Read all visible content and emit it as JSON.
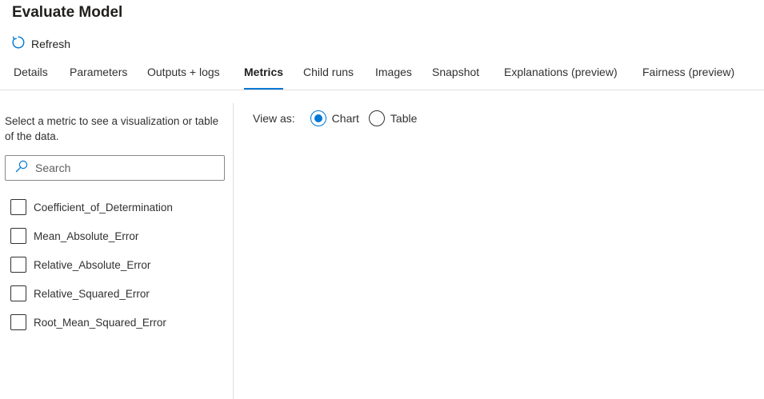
{
  "header": {
    "title": "Evaluate Model"
  },
  "toolbar": {
    "refresh_label": "Refresh"
  },
  "tabs": [
    {
      "label": "Details",
      "active": false
    },
    {
      "label": "Parameters",
      "active": false
    },
    {
      "label": "Outputs + logs",
      "active": false
    },
    {
      "label": "Metrics",
      "active": true
    },
    {
      "label": "Child runs",
      "active": false
    },
    {
      "label": "Images",
      "active": false
    },
    {
      "label": "Snapshot",
      "active": false
    },
    {
      "label": "Explanations (preview)",
      "active": false
    },
    {
      "label": "Fairness (preview)",
      "active": false
    }
  ],
  "sidebar": {
    "description": "Select a metric to see a visualization or table of the data.",
    "search": {
      "placeholder": "Search",
      "value": ""
    },
    "metrics": [
      {
        "label": "Coefficient_of_Determination",
        "checked": false
      },
      {
        "label": "Mean_Absolute_Error",
        "checked": false
      },
      {
        "label": "Relative_Absolute_Error",
        "checked": false
      },
      {
        "label": "Relative_Squared_Error",
        "checked": false
      },
      {
        "label": "Root_Mean_Squared_Error",
        "checked": false
      }
    ]
  },
  "view": {
    "label": "View as:",
    "options": [
      {
        "label": "Chart",
        "selected": true
      },
      {
        "label": "Table",
        "selected": false
      }
    ]
  },
  "colors": {
    "accent": "#0078d4",
    "border": "#e1dfdd",
    "text": "#201f1e"
  }
}
